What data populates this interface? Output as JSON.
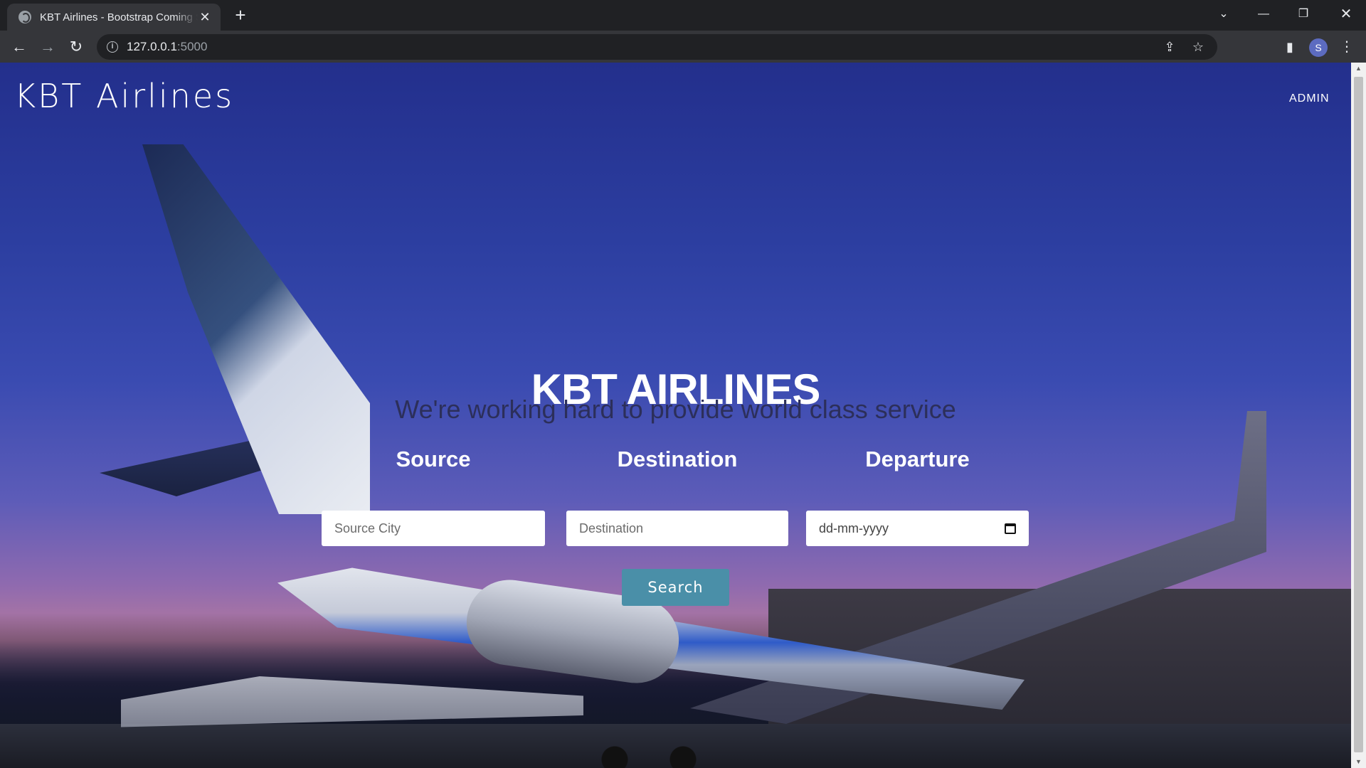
{
  "browser": {
    "tab_title": "KBT Airlines - Bootstrap Coming Soon",
    "url_host": "127.0.0.1",
    "url_port": ":5000",
    "avatar_letter": "S"
  },
  "icons": {
    "tab_close": "✕",
    "new_tab": "+",
    "tab_search": "⌄",
    "minimize": "—",
    "maximize": "❐",
    "close": "✕",
    "back": "←",
    "forward": "→",
    "reload": "↻",
    "info": "i",
    "share": "⇪",
    "star": "☆",
    "side_panel": "▮",
    "menu": "⋮",
    "scroll_up": "▲",
    "scroll_down": "▼"
  },
  "navbar": {
    "brand": "KBT Airlines",
    "admin_link": "ADMIN"
  },
  "hero": {
    "title": "KBT AIRLINES",
    "subtitle": "We're working hard to provide world class service"
  },
  "search_form": {
    "source_label": "Source",
    "source_placeholder": "Source City",
    "destination_label": "Destination",
    "destination_placeholder": "Destination",
    "departure_label": "Departure",
    "departure_value": "dd-mm-yyyy",
    "submit_label": "Search"
  },
  "colors": {
    "accent_button": "#4a8fa8",
    "subtitle_text": "#2c2f5a"
  }
}
